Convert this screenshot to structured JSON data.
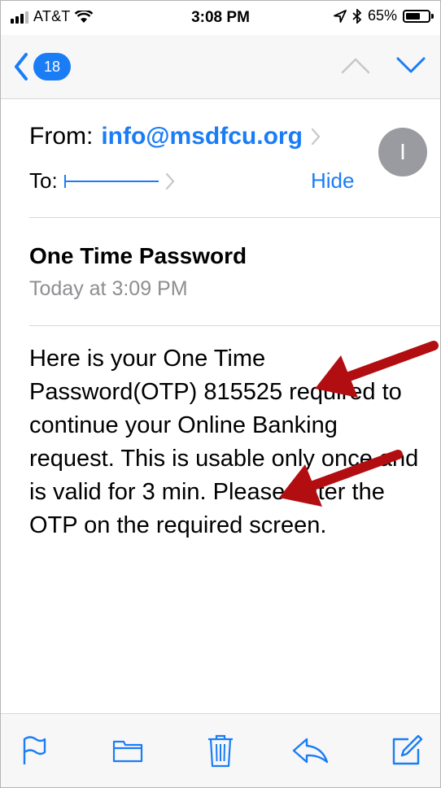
{
  "status_bar": {
    "carrier": "AT&T",
    "time": "3:08 PM",
    "battery": "65%",
    "battery_level": 0.65
  },
  "nav": {
    "back_count": "18",
    "icons": [
      "chevron-left-icon",
      "chevron-up-icon",
      "chevron-down-icon"
    ]
  },
  "header": {
    "from_label": "From:",
    "from_address": "info@msdfcu.org",
    "to_label": "To:",
    "hide_label": "Hide",
    "avatar_initial": "I"
  },
  "message": {
    "subject": "One Time Password",
    "date": "Today at 3:09 PM",
    "body": "Here is your One Time Password(OTP) 815525 required to continue your Online Banking request. This is usable only once and is valid for 3 min. Please enter the OTP on the required screen."
  },
  "toolbar": {
    "icons": [
      "flag-icon",
      "folder-icon",
      "trash-icon",
      "reply-icon",
      "compose-icon"
    ]
  },
  "colors": {
    "accent": "#1a7df6",
    "annotation": "#b20e12",
    "secondary_text": "#8e8e93"
  }
}
